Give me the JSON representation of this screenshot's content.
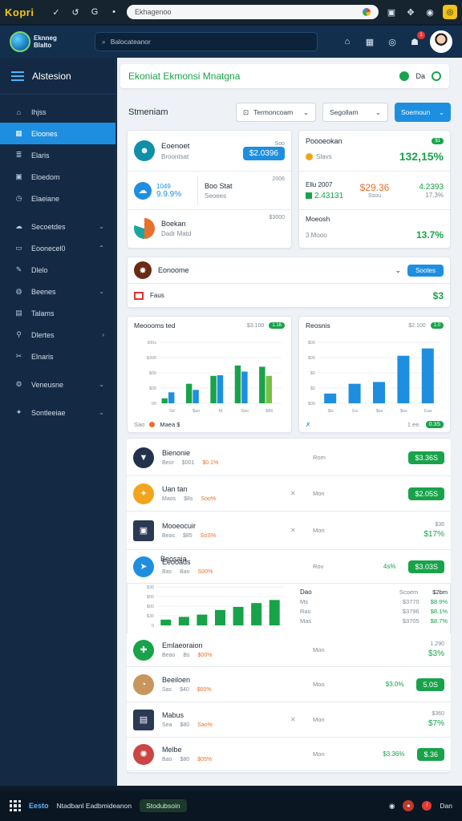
{
  "browser": {
    "brand": "Kopri",
    "url": "Ekhagenoo",
    "icons": [
      "check-icon",
      "back-icon",
      "g-icon",
      "search-icon",
      "globe-icon",
      "square-icon",
      "puzzle-icon",
      "profile-icon"
    ]
  },
  "header": {
    "logo_line1": "Eknneg",
    "logo_line2": "Blalto",
    "search_placeholder": "Balocateanor",
    "badge": "1"
  },
  "sidebar": {
    "title": "Alstesion",
    "items": [
      {
        "label": "Ihjss",
        "icon": "home-icon",
        "chevron": ""
      },
      {
        "label": "Eloones",
        "icon": "grid-icon",
        "chevron": "",
        "active": true
      },
      {
        "label": "Elaris",
        "icon": "layers-icon",
        "chevron": ""
      },
      {
        "label": "Eloedom",
        "icon": "image-icon",
        "chevron": ""
      },
      {
        "label": "Elaeiane",
        "icon": "clock-icon",
        "chevron": ""
      },
      {
        "label": "Secoetdes",
        "icon": "cloud-icon",
        "chevron": "⌄"
      },
      {
        "label": "Eoonecel0",
        "icon": "card-icon",
        "chevron": "⌃"
      },
      {
        "label": "Dlelo",
        "icon": "edit-icon",
        "chevron": ""
      },
      {
        "label": "Beenes",
        "icon": "globe-icon",
        "chevron": "⌄"
      },
      {
        "label": "Talams",
        "icon": "table-icon",
        "chevron": ""
      },
      {
        "label": "Dlertes",
        "icon": "chart-icon",
        "chevron": "›"
      },
      {
        "label": "Elnaris",
        "icon": "tools-icon",
        "chevron": ""
      },
      {
        "label": "Veneusne",
        "icon": "settings-icon",
        "chevron": "⌄"
      },
      {
        "label": "Sontleeiae",
        "icon": "gift-icon",
        "chevron": "⌄"
      }
    ]
  },
  "subheader": {
    "title": "Ekoniat Ekmonsi Mnatgna",
    "right_label": "Da"
  },
  "toolbar": {
    "title": "Stmeniam",
    "select1": "Termoncoam",
    "select2": "Segollam",
    "button": "Soemoun"
  },
  "cards": {
    "a": {
      "title": "Eoenoet",
      "sub": "Broontsat",
      "mini": "Soo",
      "value": "$2.0396"
    },
    "b": {
      "n1": "1049",
      "n2": "9.9.9%",
      "title": "Boo Stat",
      "sub": "Seoees",
      "mini": "2006"
    },
    "c": {
      "title": "Boekan",
      "sub": "Dadr Matd",
      "mini": "$3000"
    },
    "d": {
      "title": "Poooeokan",
      "sub": "Slavs",
      "badge": "$1",
      "pct": "132,15%"
    },
    "e": {
      "l1": "Ellu 2007",
      "l2": "2.43131",
      "mid": "$29.36",
      "mid2": "Ssou",
      "r1": "4.2393",
      "r2": "17.3%"
    },
    "f": {
      "title": "Moeosh",
      "sub": "3.Mooo",
      "pct": "13.7%"
    },
    "g": {
      "title": "Eonoome",
      "sub": "Faus",
      "button": "Sootes",
      "value": "$3"
    }
  },
  "colors": {
    "accent": "#1e8fe0",
    "green": "#18a34a",
    "sidebar": "#142a44",
    "orange": "#e8702a"
  },
  "chart_data": [
    {
      "type": "bar",
      "title": "Meoooms ted",
      "badge_left": "$3.100",
      "badge": "1.16",
      "y_ticks": [
        "300s",
        "$300",
        "$00",
        "$00",
        "00"
      ],
      "categories": [
        "Sd",
        "$ao",
        "fd",
        "Sao",
        "$86"
      ],
      "series": [
        {
          "color": "#18a34a",
          "values": [
            8,
            32,
            45,
            62,
            60
          ]
        },
        {
          "color": "#1e8fe0",
          "values": [
            18,
            22,
            46,
            52,
            0
          ]
        },
        {
          "color": "#76c143",
          "values": [
            0,
            0,
            0,
            0,
            45
          ]
        }
      ],
      "ylim": [
        0,
        100
      ],
      "footer_left": "Sao",
      "footer_right": "Maea $"
    },
    {
      "type": "bar",
      "title": "Reosnis",
      "badge_left": "$2.100",
      "badge": "1.0",
      "y_ticks": [
        "$00",
        "$00",
        "$0",
        "$0",
        "$00"
      ],
      "categories": [
        "$is",
        "Ea",
        "$as",
        "$as",
        "Eas"
      ],
      "series": [
        {
          "color": "#1e8fe0",
          "values": [
            16,
            32,
            35,
            78,
            90
          ]
        }
      ],
      "ylim": [
        0,
        100
      ],
      "footer_right": "1 ee.",
      "footer_badge": "0.3S"
    },
    {
      "type": "bar",
      "title": "Beosaia",
      "y_ticks": [
        "$30",
        "$00",
        "$00",
        "$30",
        "0"
      ],
      "categories": [
        "",
        "",
        "",
        "",
        "",
        "",
        ""
      ],
      "series": [
        {
          "color": "#18a34a",
          "values": [
            15,
            22,
            28,
            40,
            48,
            58,
            66
          ]
        }
      ],
      "ylim": [
        0,
        100
      ]
    }
  ],
  "list": [
    {
      "icon": "bird-icon",
      "name": "Bienonie",
      "sub": "Beor",
      "a": "$001",
      "b": "$0.1%",
      "mid": "Rom",
      "right": "",
      "badge": "$3.36S",
      "iconColor": "#22324a",
      "round": true
    },
    {
      "icon": "pin-icon",
      "name": "Uan tan",
      "sub": "Maos",
      "a": "$8s",
      "b": "Soo%",
      "mid": "Mon",
      "right": "",
      "badge": "$2.05S",
      "iconColor": "#f4a41c",
      "round": true,
      "x": "✕"
    },
    {
      "icon": "tablet-icon",
      "name": "Mooeocuir",
      "sub": "Beas",
      "a": "$85",
      "b": "SoS%",
      "mid": "Mon",
      "right": "$36",
      "rightpct": "$17%",
      "iconColor": "#2a3a54",
      "round": false,
      "x": "✕"
    },
    {
      "icon": "nav-icon",
      "name": "Eeooads",
      "sub": "Bas",
      "a": "Bao",
      "b": "S00%",
      "mid": "Rov",
      "right": "4s%",
      "badge": "$3.03S",
      "iconColor": "#1e8fe0",
      "round": true
    }
  ],
  "sumbox": {
    "h1": "Dao",
    "h2": "Scoem",
    "h3": "$2bm",
    "rows": [
      {
        "l": "Ms",
        "m": "$3770",
        "r": "$8.9%"
      },
      {
        "l": "Ras",
        "m": "$3796",
        "r": "$8.1%"
      },
      {
        "l": "Mas",
        "m": "$3705",
        "r": "$8.7%"
      }
    ]
  },
  "list2": [
    {
      "icon": "puzzle-icon",
      "name": "Emlaeoraion",
      "sub": "Beao",
      "a": "Bs",
      "b": "$00%",
      "mid": "Mon",
      "right": "1.290",
      "rightpct": "$3%",
      "iconColor": "#18a34a",
      "round": true
    },
    {
      "icon": "pie-icon",
      "name": "Beeiloen",
      "sub": "Sas",
      "a": "$40",
      "b": "$00%",
      "mid": "Moo",
      "right": "$3.0%",
      "badge": "5.0S",
      "iconColor": "#c9955c",
      "round": true
    },
    {
      "icon": "box-icon",
      "name": "Mabus",
      "sub": "Sea",
      "a": "$80",
      "b": "Sao%",
      "mid": "Mon",
      "right": "$360",
      "rightpct": "$7%",
      "iconColor": "#2a3a54",
      "round": false,
      "x": "✕"
    },
    {
      "icon": "wheel-icon",
      "name": "Melbe",
      "sub": "Bao",
      "a": "$80",
      "b": "$05%",
      "mid": "Mon",
      "right": "$3.36%",
      "badge": "$.36",
      "iconColor": "#c44",
      "round": true
    }
  ],
  "taskbar": {
    "app": "Eesto",
    "title": "Ntadbanl Eadbmideanon",
    "tag": "Stodubsoin",
    "time": "Dan"
  }
}
